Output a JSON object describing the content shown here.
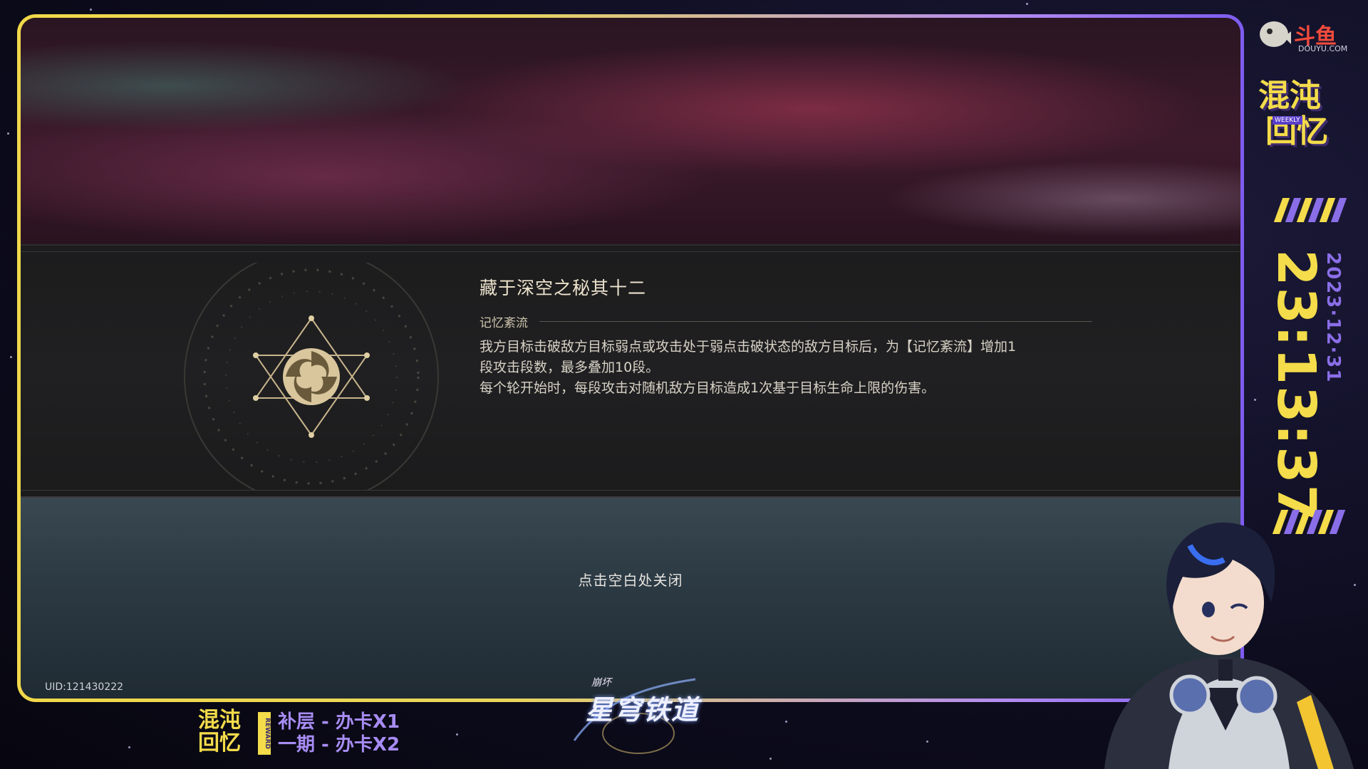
{
  "blessing": {
    "title": "藏于深空之秘其十二",
    "path": "记忆紊流",
    "description_line1": "我方目标击破敌方目标弱点或攻击处于弱点击破状态的敌方目标后，为【记忆紊流】增加1",
    "description_line2": "段攻击段数，最多叠加10段。",
    "description_line3": "每个轮开始时，每段攻击对随机敌方目标造成1次基于目标生命上限的伤害。"
  },
  "close_hint": "点击空白处关闭",
  "uid": "UID:121430222",
  "overlay": {
    "platform_cn": "斗鱼",
    "platform_en": "DOUYU.COM",
    "event_title_1": "混沌",
    "event_title_2": "回忆",
    "weekly_tag": "WEEKLY",
    "clock": "23:13:37",
    "date": "2023·12·31",
    "reward_title_1": "混沌",
    "reward_title_2": "回忆",
    "reward_tag": "REWARD",
    "reward_line1": "补层 - 办卡X1",
    "reward_line2": "一期 - 办卡X2",
    "game_logo_small": "崩坏",
    "game_logo_big": "星穹铁道"
  },
  "colors": {
    "accent_yellow": "#f4dc4a",
    "accent_purple": "#8a6ee8",
    "frame_border_start": "#f1d84a",
    "frame_border_end": "#7d5cf0",
    "douyu_red": "#f24b3c"
  },
  "icons": {
    "emblem": "memory-turbulence-emblem-icon",
    "platform_logo": "douyu-fish-icon"
  }
}
